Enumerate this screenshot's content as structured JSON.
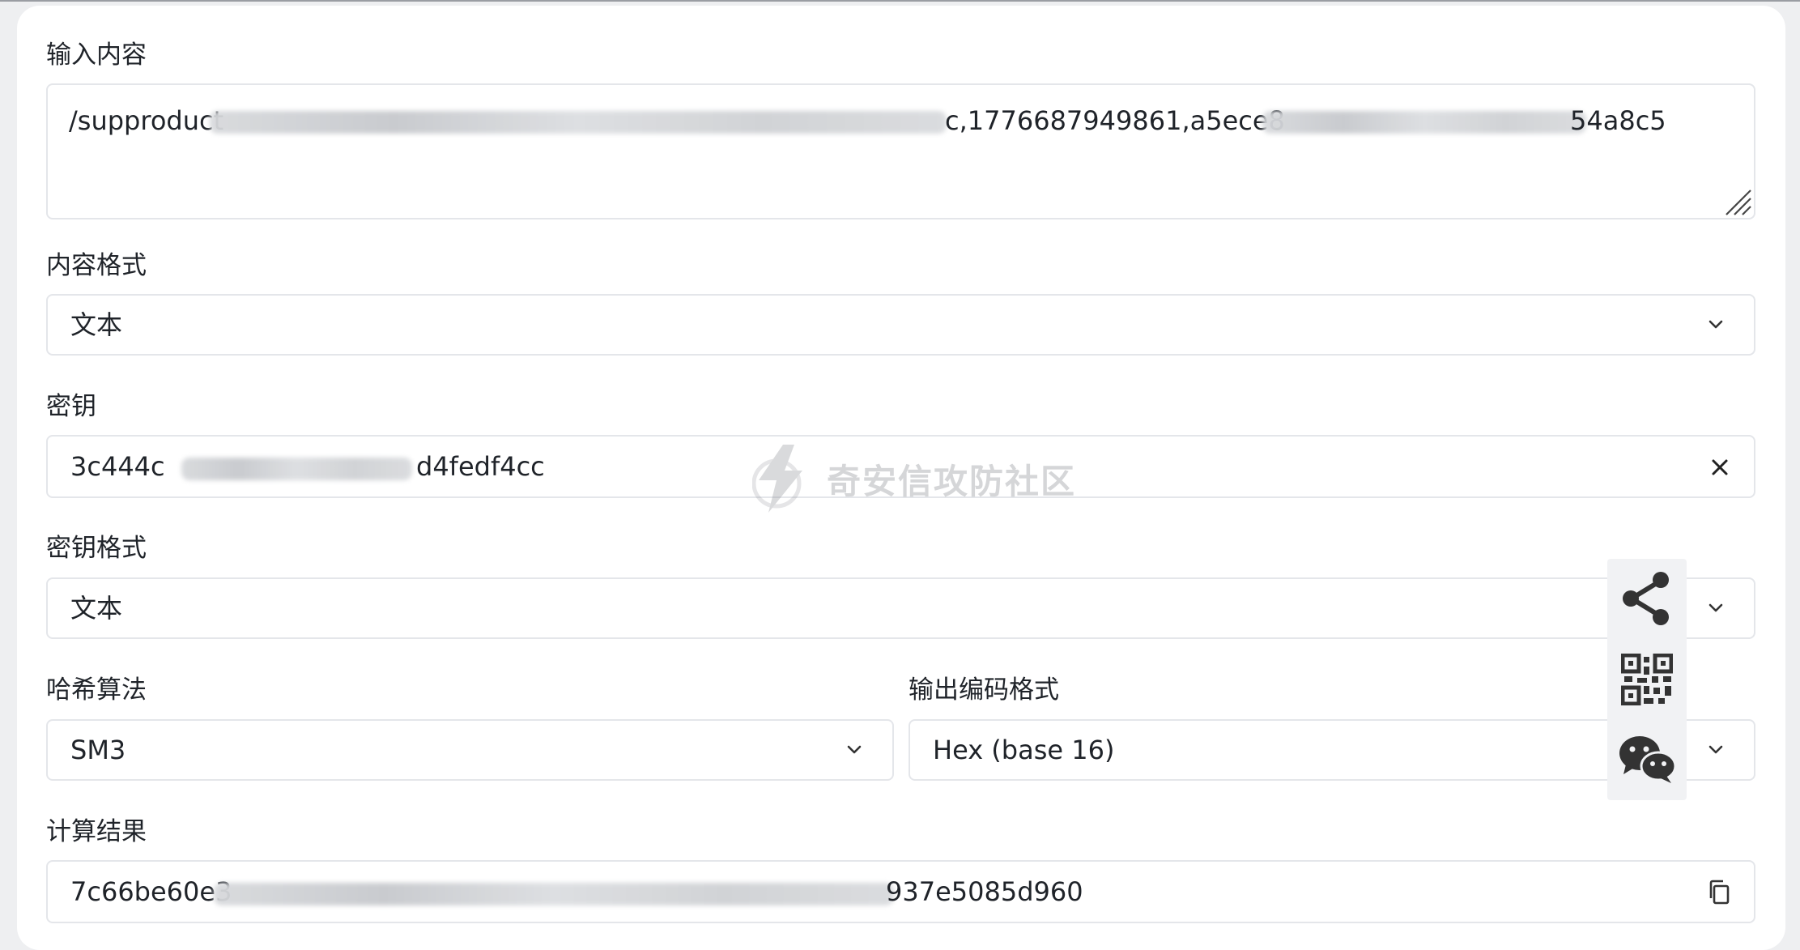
{
  "form": {
    "input_label": "输入内容",
    "input_value_prefix": "/supproduct",
    "input_value_middle": "c,1776687949861,a5ece8",
    "input_value_suffix": "54a8c5",
    "content_format_label": "内容格式",
    "content_format_value": "文本",
    "key_label": "密钥",
    "key_value_prefix": "3c444c",
    "key_value_suffix": "d4fedf4cc",
    "key_format_label": "密钥格式",
    "key_format_value": "文本",
    "hash_algorithm_label": "哈希算法",
    "hash_algorithm_value": "SM3",
    "output_encoding_label": "输出编码格式",
    "output_encoding_value": "Hex (base 16)",
    "result_label": "计算结果",
    "result_value_prefix": "7c66be60e3",
    "result_value_suffix": "937e5085d960"
  },
  "watermark": {
    "text": "奇安信攻防社区"
  },
  "icons": {
    "dropdown": "chevron-down-icon",
    "clear": "close-icon",
    "copy": "copy-icon",
    "share": "share-icon",
    "qrcode": "qrcode-icon",
    "wechat": "wechat-icon"
  },
  "colors": {
    "border": "#e4e6ea",
    "text": "#1f2329",
    "icon": "#333333",
    "watermark": "#6c7077"
  }
}
